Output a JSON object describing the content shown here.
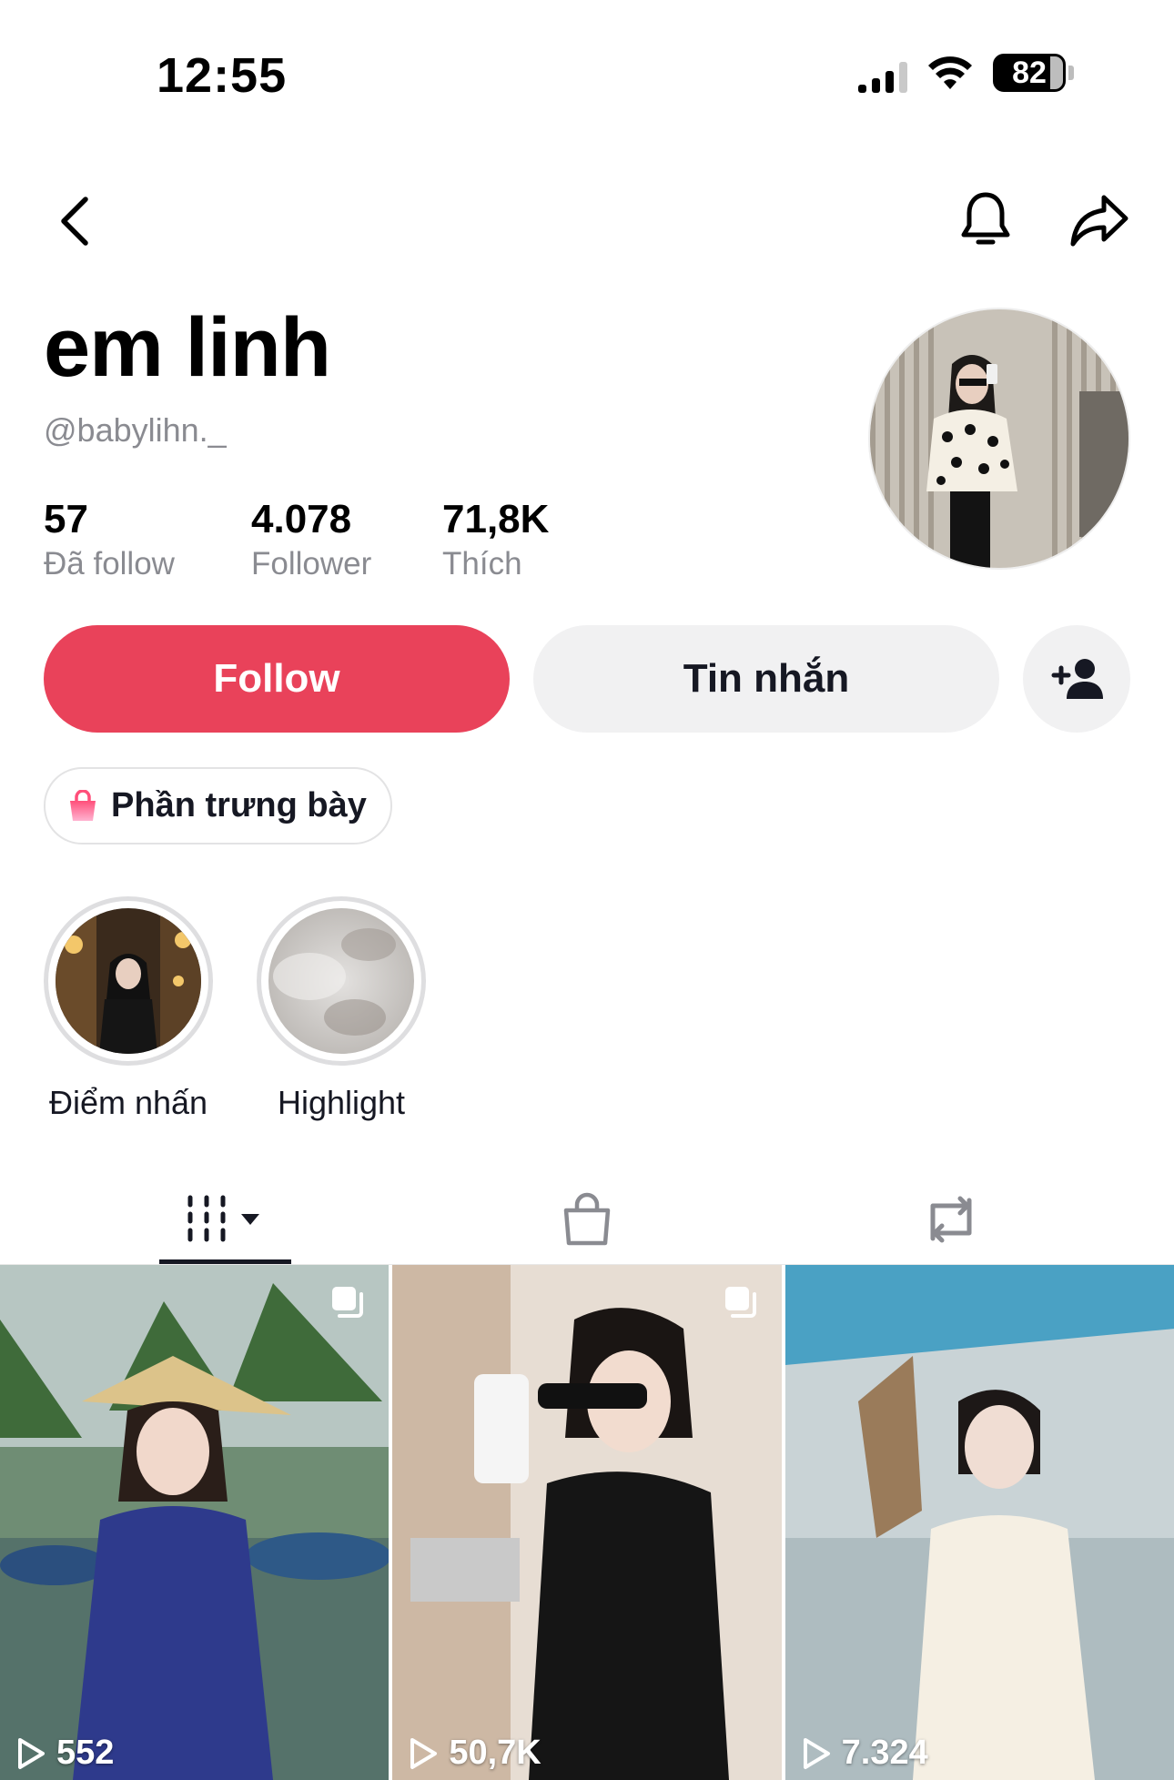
{
  "status_bar": {
    "time": "12:55",
    "battery": "82"
  },
  "profile": {
    "display_name": "em linh",
    "handle": "@babylihn._"
  },
  "stats": [
    {
      "value": "57",
      "label": "Đã follow"
    },
    {
      "value": "4.078",
      "label": "Follower"
    },
    {
      "value": "71,8K",
      "label": "Thích"
    }
  ],
  "actions": {
    "follow_label": "Follow",
    "message_label": "Tin nhắn",
    "showcase_label": "Phần trưng bày"
  },
  "highlights": [
    {
      "label": "Điểm nhấn"
    },
    {
      "label": "Highlight"
    }
  ],
  "videos": [
    {
      "views": "552"
    },
    {
      "views": "50,7K"
    },
    {
      "views": "7.324"
    }
  ],
  "colors": {
    "follow": "#e9425a",
    "secondary_button": "#f1f1f2",
    "muted_text": "#8a8b91"
  },
  "icons": {
    "back": "chevron-left-icon",
    "notifications": "bell-icon",
    "share": "share-arrow-icon",
    "add_friend": "add-user-icon",
    "showcase": "shopping-bag-icon",
    "videos_tab": "grid-dropdown-icon",
    "shop_tab": "shopping-bag-icon",
    "reposts_tab": "repost-icon",
    "views": "play-icon",
    "multi": "carousel-icon"
  }
}
